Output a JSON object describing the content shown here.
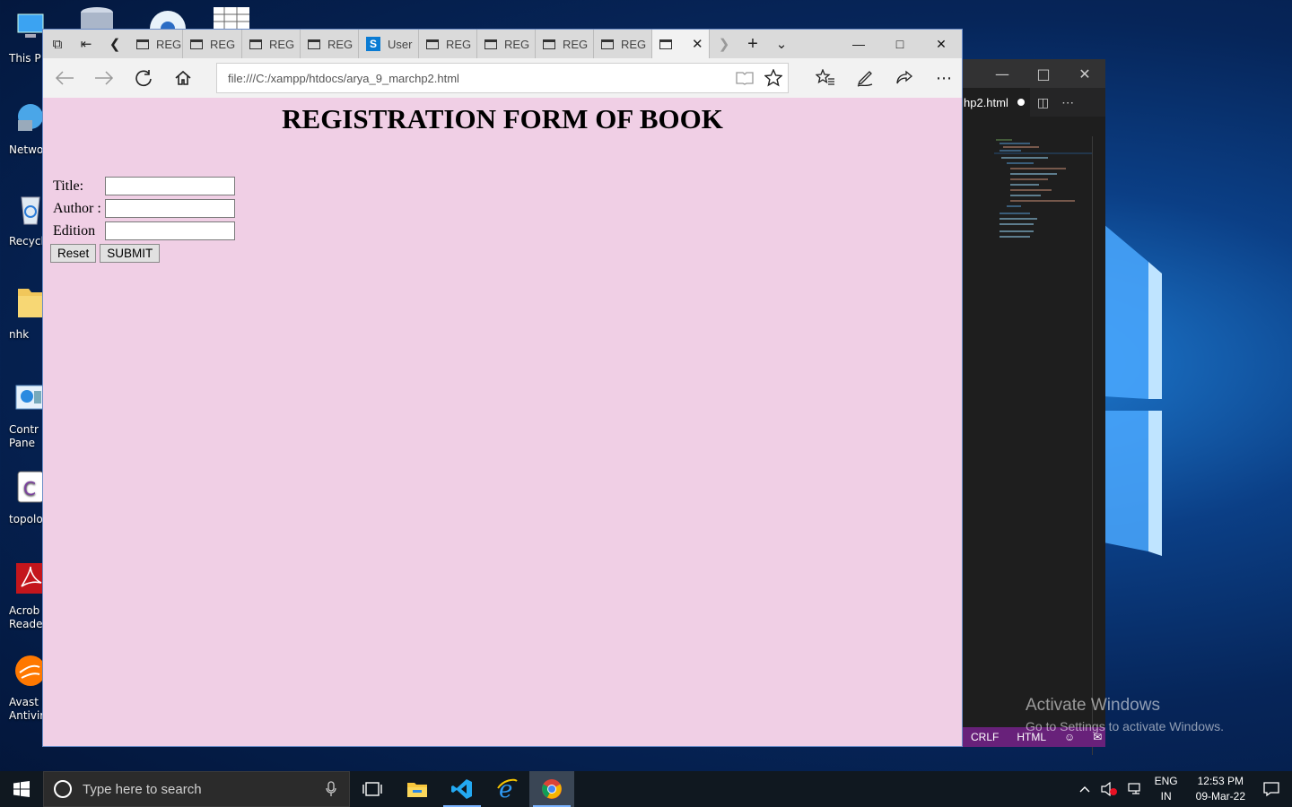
{
  "desktop": {
    "icons": [
      {
        "label": "This P",
        "icon": "computer-icon"
      },
      {
        "label": "Netwo",
        "icon": "network-icon"
      },
      {
        "label": "Recycle",
        "icon": "recycle-bin-icon"
      },
      {
        "label": "nhk",
        "icon": "folder-icon"
      },
      {
        "label": "Contr\nPane",
        "icon": "control-panel-icon"
      },
      {
        "label": "topologi",
        "icon": "document-icon"
      },
      {
        "label": "Acrob\nReader",
        "icon": "acrobat-icon"
      },
      {
        "label": "Avast F\nAntivir",
        "icon": "avast-icon"
      }
    ],
    "activation": {
      "line1": "Activate Windows",
      "line2": "Go to Settings to activate Windows."
    }
  },
  "vscode": {
    "tab_label": "hp2.html",
    "status_items": [
      "CRLF",
      "HTML"
    ]
  },
  "browser": {
    "tabs": [
      {
        "label": "REG"
      },
      {
        "label": "REG"
      },
      {
        "label": "REG"
      },
      {
        "label": "REG"
      },
      {
        "label": "User"
      },
      {
        "label": "REG"
      },
      {
        "label": "REG"
      },
      {
        "label": "REG"
      },
      {
        "label": "REG"
      }
    ],
    "address": "file:///C:/xampp/htdocs/arya_9_marchp2.html",
    "page": {
      "heading": "REGISTRATION FORM OF BOOK",
      "fields": {
        "title_label": "Title:",
        "author_label": "Author :",
        "edition_label": "Edition"
      },
      "reset_label": "Reset",
      "submit_label": "SUBMIT"
    }
  },
  "taskbar": {
    "search_placeholder": "Type here to search",
    "lang_top": "ENG",
    "lang_bottom": "IN",
    "time": "12:53 PM",
    "date": "09-Mar-22"
  },
  "colors": {
    "page_bg": "#f0cfe5",
    "vscode_status": "#68217a",
    "taskbar": "#101820"
  }
}
